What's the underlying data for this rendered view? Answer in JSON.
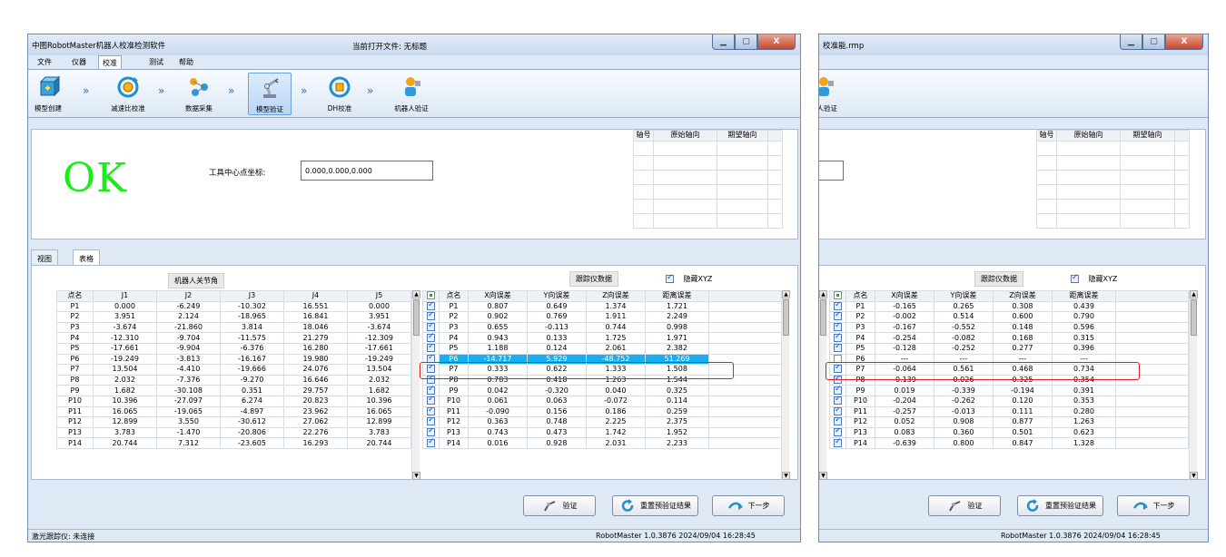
{
  "window": {
    "title": "中图RobotMaster机器人校准检测软件",
    "doc_label": "当前打开文件: 无标题",
    "title_right": "校准能.rmp",
    "controls": [
      "▁",
      "▢",
      "X"
    ]
  },
  "menu": [
    "文件",
    "仪器",
    "校准",
    "测试",
    "帮助"
  ],
  "steps": [
    {
      "label": "模型创建"
    },
    {
      "label": "减速比校准"
    },
    {
      "label": "数据采集"
    },
    {
      "label": "模型验证"
    },
    {
      "label": "DH校准"
    },
    {
      "label": "机器人验证"
    }
  ],
  "step_arrow": "»",
  "step_label_right": "人验证",
  "top": {
    "result": "OK",
    "tcp_label": "工具中心点坐标:",
    "tcp_value": "0.000,0.000,0.000",
    "axis_headers": [
      "轴号",
      "原始轴向",
      "期望轴向"
    ]
  },
  "tabs": [
    "视图",
    "表格"
  ],
  "joint_table": {
    "title": "机器人关节角",
    "headers": [
      "点名",
      "J1",
      "J2",
      "J3",
      "J4",
      "J5"
    ],
    "rows": [
      [
        "P1",
        "0.000",
        "-6.249",
        "-10.302",
        "16.551",
        "0.000"
      ],
      [
        "P2",
        "3.951",
        "2.124",
        "-18.965",
        "16.841",
        "3.951"
      ],
      [
        "P3",
        "-3.674",
        "-21.860",
        "3.814",
        "18.046",
        "-3.674"
      ],
      [
        "P4",
        "-12.310",
        "-9.704",
        "-11.575",
        "21.279",
        "-12.309"
      ],
      [
        "P5",
        "-17.661",
        "-9.904",
        "-6.376",
        "16.280",
        "-17.661"
      ],
      [
        "P6",
        "-19.249",
        "-3.813",
        "-16.167",
        "19.980",
        "-19.249"
      ],
      [
        "P7",
        "13.504",
        "-4.410",
        "-19.666",
        "24.076",
        "13.504"
      ],
      [
        "P8",
        "2.032",
        "-7.376",
        "-9.270",
        "16.646",
        "2.032"
      ],
      [
        "P9",
        "1.682",
        "-30.108",
        "0.351",
        "29.757",
        "1.682"
      ],
      [
        "P10",
        "10.396",
        "-27.097",
        "6.274",
        "20.823",
        "10.396"
      ],
      [
        "P11",
        "16.065",
        "-19.065",
        "-4.897",
        "23.962",
        "16.065"
      ],
      [
        "P12",
        "12.899",
        "3.550",
        "-30.612",
        "27.062",
        "12.899"
      ],
      [
        "P13",
        "3.783",
        "-1.470",
        "-20.806",
        "22.276",
        "3.783"
      ],
      [
        "P14",
        "20.744",
        "7.312",
        "-23.605",
        "16.293",
        "20.744"
      ]
    ]
  },
  "tracker_left": {
    "title": "跟踪仪数据",
    "hide_xyz": "隐藏XYZ",
    "headers": [
      "点名",
      "X向误差",
      "Y向误差",
      "Z向误差",
      "距离误差"
    ],
    "selected_row": 5,
    "rows": [
      [
        "P1",
        "0.807",
        "0.649",
        "1.374",
        "1.721"
      ],
      [
        "P2",
        "0.902",
        "0.769",
        "1.911",
        "2.249"
      ],
      [
        "P3",
        "0.655",
        "-0.113",
        "0.744",
        "0.998"
      ],
      [
        "P4",
        "0.943",
        "0.133",
        "1.725",
        "1.971"
      ],
      [
        "P5",
        "1.188",
        "0.124",
        "2.061",
        "2.382"
      ],
      [
        "P6",
        "-14.717",
        "5.929",
        "-48.752",
        "51.269"
      ],
      [
        "P7",
        "0.333",
        "0.622",
        "1.333",
        "1.508"
      ],
      [
        "P8",
        "0.783",
        "0.418",
        "1.263",
        "1.544"
      ],
      [
        "P9",
        "0.042",
        "-0.320",
        "0.040",
        "0.325"
      ],
      [
        "P10",
        "0.061",
        "0.063",
        "-0.072",
        "0.114"
      ],
      [
        "P11",
        "-0.090",
        "0.156",
        "0.186",
        "0.259"
      ],
      [
        "P12",
        "0.363",
        "0.748",
        "2.225",
        "2.375"
      ],
      [
        "P13",
        "0.743",
        "0.473",
        "1.742",
        "1.952"
      ],
      [
        "P14",
        "0.016",
        "0.928",
        "2.031",
        "2.233"
      ]
    ]
  },
  "tracker_right": {
    "title": "跟踪仪数据",
    "hide_xyz": "隐藏XYZ",
    "headers": [
      "点名",
      "X向误差",
      "Y向误差",
      "Z向误差",
      "距离误差"
    ],
    "unchecked_row": 5,
    "rows": [
      [
        "P1",
        "-0.165",
        "0.265",
        "0.308",
        "0.439"
      ],
      [
        "P2",
        "-0.002",
        "0.514",
        "0.600",
        "0.790"
      ],
      [
        "P3",
        "-0.167",
        "-0.552",
        "0.148",
        "0.596"
      ],
      [
        "P4",
        "-0.254",
        "-0.082",
        "0.168",
        "0.315"
      ],
      [
        "P5",
        "-0.128",
        "-0.252",
        "0.277",
        "0.396"
      ],
      [
        "P6",
        "---",
        "---",
        "---",
        "---"
      ],
      [
        "P7",
        "-0.064",
        "0.561",
        "0.468",
        "0.734"
      ],
      [
        "P8",
        "-0.139",
        "0.026",
        "0.325",
        "0.354"
      ],
      [
        "P9",
        "0.019",
        "-0.339",
        "-0.194",
        "0.391"
      ],
      [
        "P10",
        "-0.204",
        "-0.262",
        "0.120",
        "0.353"
      ],
      [
        "P11",
        "-0.257",
        "-0.013",
        "0.111",
        "0.280"
      ],
      [
        "P12",
        "0.052",
        "0.908",
        "0.877",
        "1.263"
      ],
      [
        "P13",
        "0.083",
        "0.360",
        "0.501",
        "0.623"
      ],
      [
        "P14",
        "-0.639",
        "0.800",
        "0.847",
        "1.328"
      ]
    ]
  },
  "buttons": {
    "verify": "验证",
    "reset": "重置预验证结果",
    "next": "下一步"
  },
  "status": {
    "tracker": "激光跟踪仪: 未连接",
    "version": "RobotMaster 1.0.3876 2024/09/04 16:28:45"
  },
  "colors": {
    "ok": "#16ee16",
    "selection": "#17aff0",
    "highlight": "#e02020"
  }
}
